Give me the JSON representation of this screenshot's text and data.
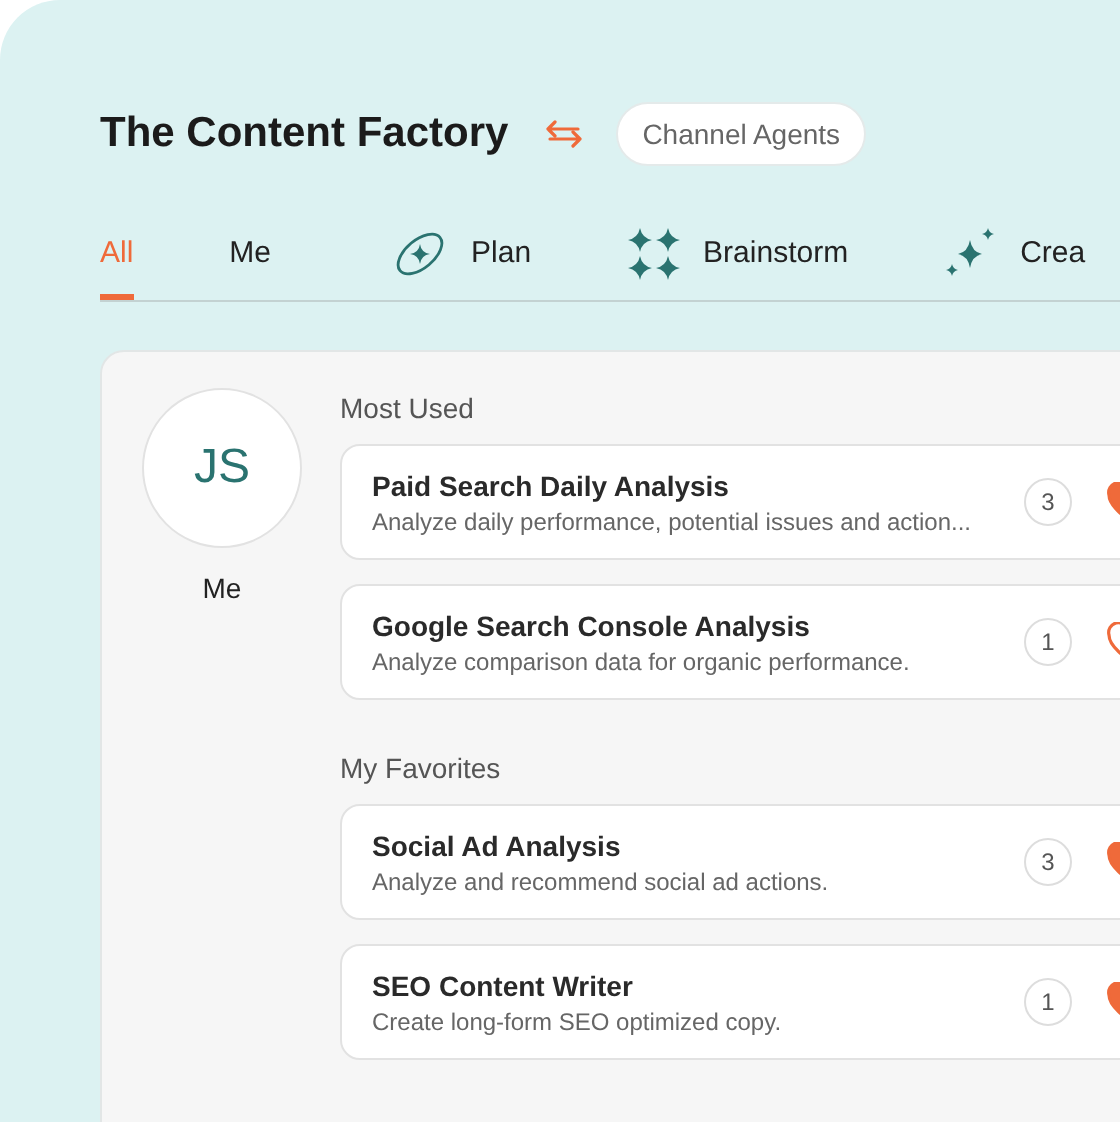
{
  "header": {
    "title": "The Content Factory",
    "switch_chip": "Channel Agents"
  },
  "tabs": [
    {
      "label": "All",
      "selected": true
    },
    {
      "label": "Me",
      "selected": false
    },
    {
      "label": "Plan",
      "selected": false
    },
    {
      "label": "Brainstorm",
      "selected": false
    },
    {
      "label": "Crea",
      "selected": false
    }
  ],
  "user": {
    "initials": "JS",
    "label": "Me"
  },
  "sections": [
    {
      "title": "Most Used",
      "agents": [
        {
          "name": "Paid Search Daily Analysis",
          "description": "Analyze daily performance, potential issues and action...",
          "count": "3",
          "favorite": true
        },
        {
          "name": "Google Search Console Analysis",
          "description": "Analyze comparison data for organic performance.",
          "count": "1",
          "favorite": false
        }
      ]
    },
    {
      "title": "My Favorites",
      "agents": [
        {
          "name": "Social Ad Analysis",
          "description": "Analyze and recommend social ad actions.",
          "count": "3",
          "favorite": true
        },
        {
          "name": "SEO Content Writer",
          "description": "Create long-form SEO optimized copy.",
          "count": "1",
          "favorite": true
        }
      ]
    }
  ]
}
